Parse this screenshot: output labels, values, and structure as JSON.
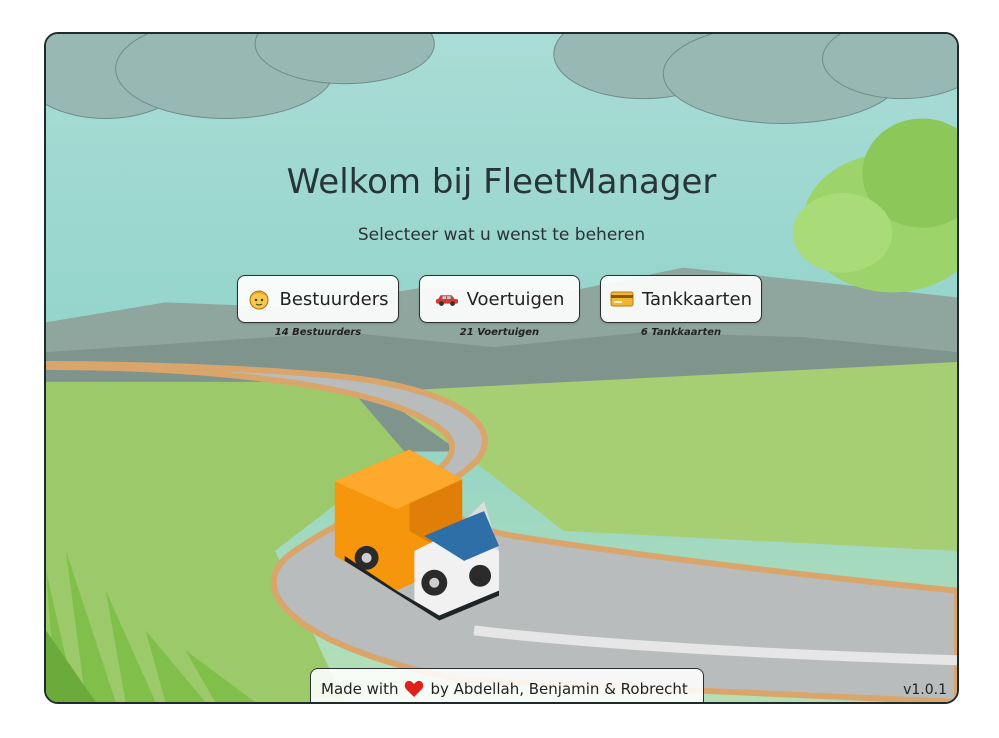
{
  "page": {
    "title": "Welkom bij FleetManager",
    "subtitle": "Selecteer wat u wenst te beheren"
  },
  "nav": [
    {
      "label": "Bestuurders",
      "count": "14 Bestuurders",
      "icon": "driver-face-icon"
    },
    {
      "label": "Voertuigen",
      "count": "21 Voertuigen",
      "icon": "car-icon"
    },
    {
      "label": "Tankkaarten",
      "count": "6 Tankkaarten",
      "icon": "fuel-card-icon"
    }
  ],
  "footer": {
    "made_with": "Made with",
    "by_text": "by Abdellah, Benjamin & Robrecht",
    "icon": "heart-icon"
  },
  "version": "v1.0.1",
  "colors": {
    "sky": "#8fd3d0",
    "road": "#b9bcbd",
    "grass": "#9cc96a",
    "truck_cargo": "#f5960c",
    "heart": "#e0201a"
  }
}
